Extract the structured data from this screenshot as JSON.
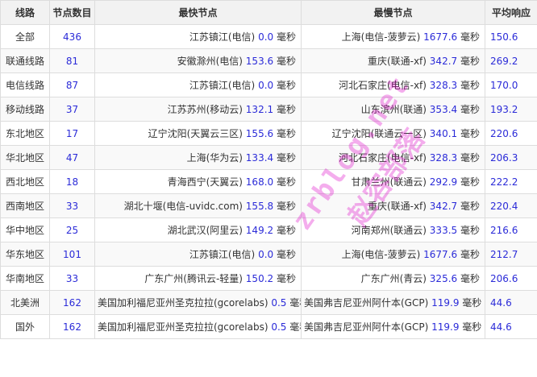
{
  "headers": {
    "line": "线路",
    "count": "节点数目",
    "fastest": "最快节点",
    "slowest": "最慢节点",
    "avg": "平均响应"
  },
  "unit": "毫秒",
  "rows": [
    {
      "line": "全部",
      "count": "436",
      "fast_name": "江苏镇江(电信)",
      "fast_val": "0.0",
      "slow_name": "上海(电信-菠萝云)",
      "slow_val": "1677.6",
      "avg": "150.6"
    },
    {
      "line": "联通线路",
      "count": "81",
      "fast_name": "安徽滁州(电信)",
      "fast_val": "153.6",
      "slow_name": "重庆(联通-xf)",
      "slow_val": "342.7",
      "avg": "269.2"
    },
    {
      "line": "电信线路",
      "count": "87",
      "fast_name": "江苏镇江(电信)",
      "fast_val": "0.0",
      "slow_name": "河北石家庄(电信-xf)",
      "slow_val": "328.3",
      "avg": "170.0"
    },
    {
      "line": "移动线路",
      "count": "37",
      "fast_name": "江苏苏州(移动云)",
      "fast_val": "132.1",
      "slow_name": "山东滨州(联通)",
      "slow_val": "353.4",
      "avg": "193.2"
    },
    {
      "line": "东北地区",
      "count": "17",
      "fast_name": "辽宁沈阳(天翼云三区)",
      "fast_val": "155.6",
      "slow_name": "辽宁沈阳(联通云一区)",
      "slow_val": "340.1",
      "avg": "220.6"
    },
    {
      "line": "华北地区",
      "count": "47",
      "fast_name": "上海(华为云)",
      "fast_val": "133.4",
      "slow_name": "河北石家庄(电信-xf)",
      "slow_val": "328.3",
      "avg": "206.3"
    },
    {
      "line": "西北地区",
      "count": "18",
      "fast_name": "青海西宁(天翼云)",
      "fast_val": "168.0",
      "slow_name": "甘肃兰州(联通云)",
      "slow_val": "292.9",
      "avg": "222.2"
    },
    {
      "line": "西南地区",
      "count": "33",
      "fast_name": "湖北十堰(电信-uvidc.com)",
      "fast_val": "155.8",
      "slow_name": "重庆(联通-xf)",
      "slow_val": "342.7",
      "avg": "220.4"
    },
    {
      "line": "华中地区",
      "count": "25",
      "fast_name": "湖北武汉(阿里云)",
      "fast_val": "149.2",
      "slow_name": "河南郑州(联通云)",
      "slow_val": "333.5",
      "avg": "216.6"
    },
    {
      "line": "华东地区",
      "count": "101",
      "fast_name": "江苏镇江(电信)",
      "fast_val": "0.0",
      "slow_name": "上海(电信-菠萝云)",
      "slow_val": "1677.6",
      "avg": "212.7"
    },
    {
      "line": "华南地区",
      "count": "33",
      "fast_name": "广东广州(腾讯云-轻量)",
      "fast_val": "150.2",
      "slow_name": "广东广州(青云)",
      "slow_val": "325.6",
      "avg": "206.6"
    },
    {
      "line": "北美洲",
      "count": "162",
      "fast_name": "美国加利福尼亚州圣克拉拉(gcorelabs)",
      "fast_val": "0.5",
      "slow_name": "美国弗吉尼亚州阿什本(GCP)",
      "slow_val": "119.9",
      "avg": "44.6"
    },
    {
      "line": "国外",
      "count": "162",
      "fast_name": "美国加利福尼亚州圣克拉拉(gcorelabs)",
      "fast_val": "0.5",
      "slow_name": "美国弗吉尼亚州阿什本(GCP)",
      "slow_val": "119.9",
      "avg": "44.6"
    }
  ],
  "watermark": {
    "line1": "zrblog.net",
    "line2": "赵容部落"
  },
  "colors": {
    "number": "#2b2bd8",
    "border": "#dddddd",
    "header_bg": "#f2f2f2",
    "watermark": "#dc00c8"
  }
}
